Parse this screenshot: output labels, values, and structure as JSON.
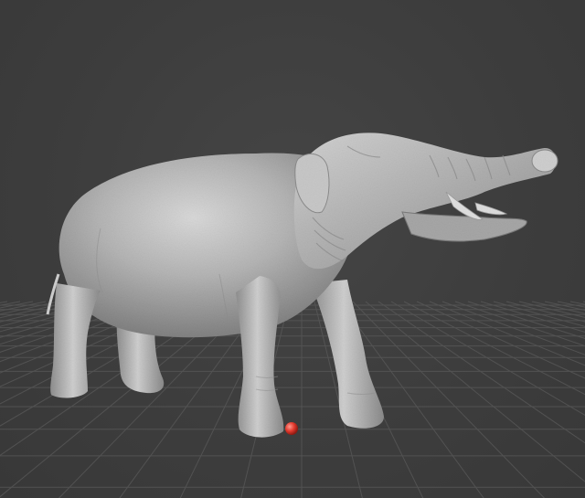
{
  "viewport": {
    "background_color": "#3d3d3d",
    "grid_color": "#5a5a5a"
  },
  "model": {
    "kind": "sculpted-mesh",
    "subject_icon": "proboscidean-sculpt",
    "mesh_color": "#bdbdbd"
  },
  "pivot_marker": {
    "icon": "red-sphere-icon",
    "color": "#e23a2e"
  }
}
